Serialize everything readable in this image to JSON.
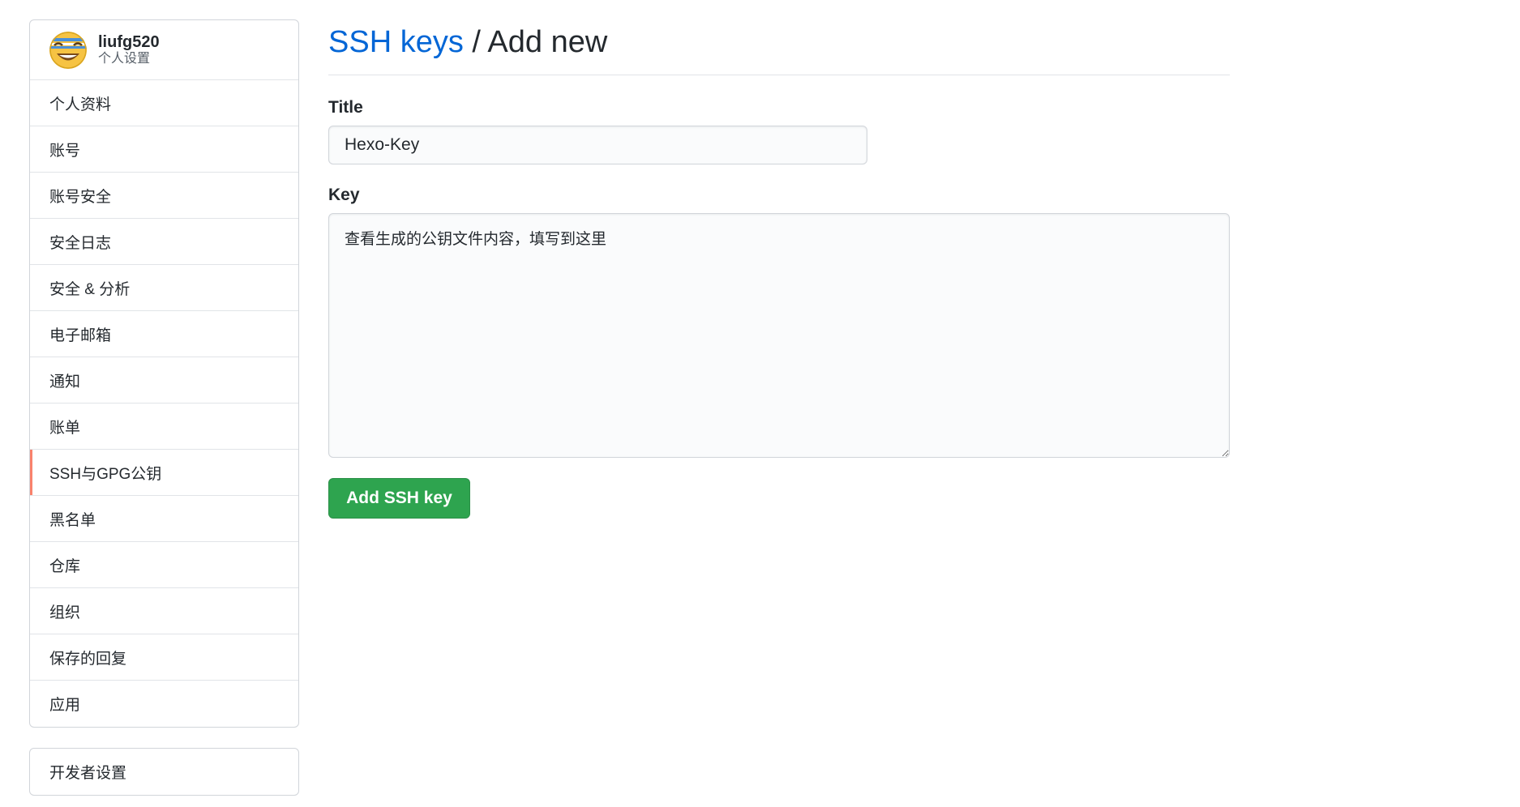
{
  "user": {
    "username": "liufg520",
    "subtitle": "个人设置",
    "avatar_icon": "smiley-avatar-icon"
  },
  "sidebar": {
    "items": [
      {
        "label": "个人资料",
        "selected": false
      },
      {
        "label": "账号",
        "selected": false
      },
      {
        "label": "账号安全",
        "selected": false
      },
      {
        "label": "安全日志",
        "selected": false
      },
      {
        "label": "安全 & 分析",
        "selected": false
      },
      {
        "label": "电子邮箱",
        "selected": false
      },
      {
        "label": "通知",
        "selected": false
      },
      {
        "label": "账单",
        "selected": false
      },
      {
        "label": "SSH与GPG公钥",
        "selected": true
      },
      {
        "label": "黑名单",
        "selected": false
      },
      {
        "label": "仓库",
        "selected": false
      },
      {
        "label": "组织",
        "selected": false
      },
      {
        "label": "保存的回复",
        "selected": false
      },
      {
        "label": "应用",
        "selected": false
      }
    ],
    "developer": {
      "label": "开发者设置"
    }
  },
  "main": {
    "breadcrumb_link": "SSH keys",
    "breadcrumb_separator": " / ",
    "breadcrumb_current": "Add new",
    "title_label": "Title",
    "title_value": "Hexo-Key",
    "key_label": "Key",
    "key_value": "查看生成的公钥文件内容，填写到这里",
    "submit_label": "Add SSH key"
  },
  "colors": {
    "link": "#0366d6",
    "primary_button": "#2ea44f",
    "selected_indicator": "#f9826c"
  }
}
